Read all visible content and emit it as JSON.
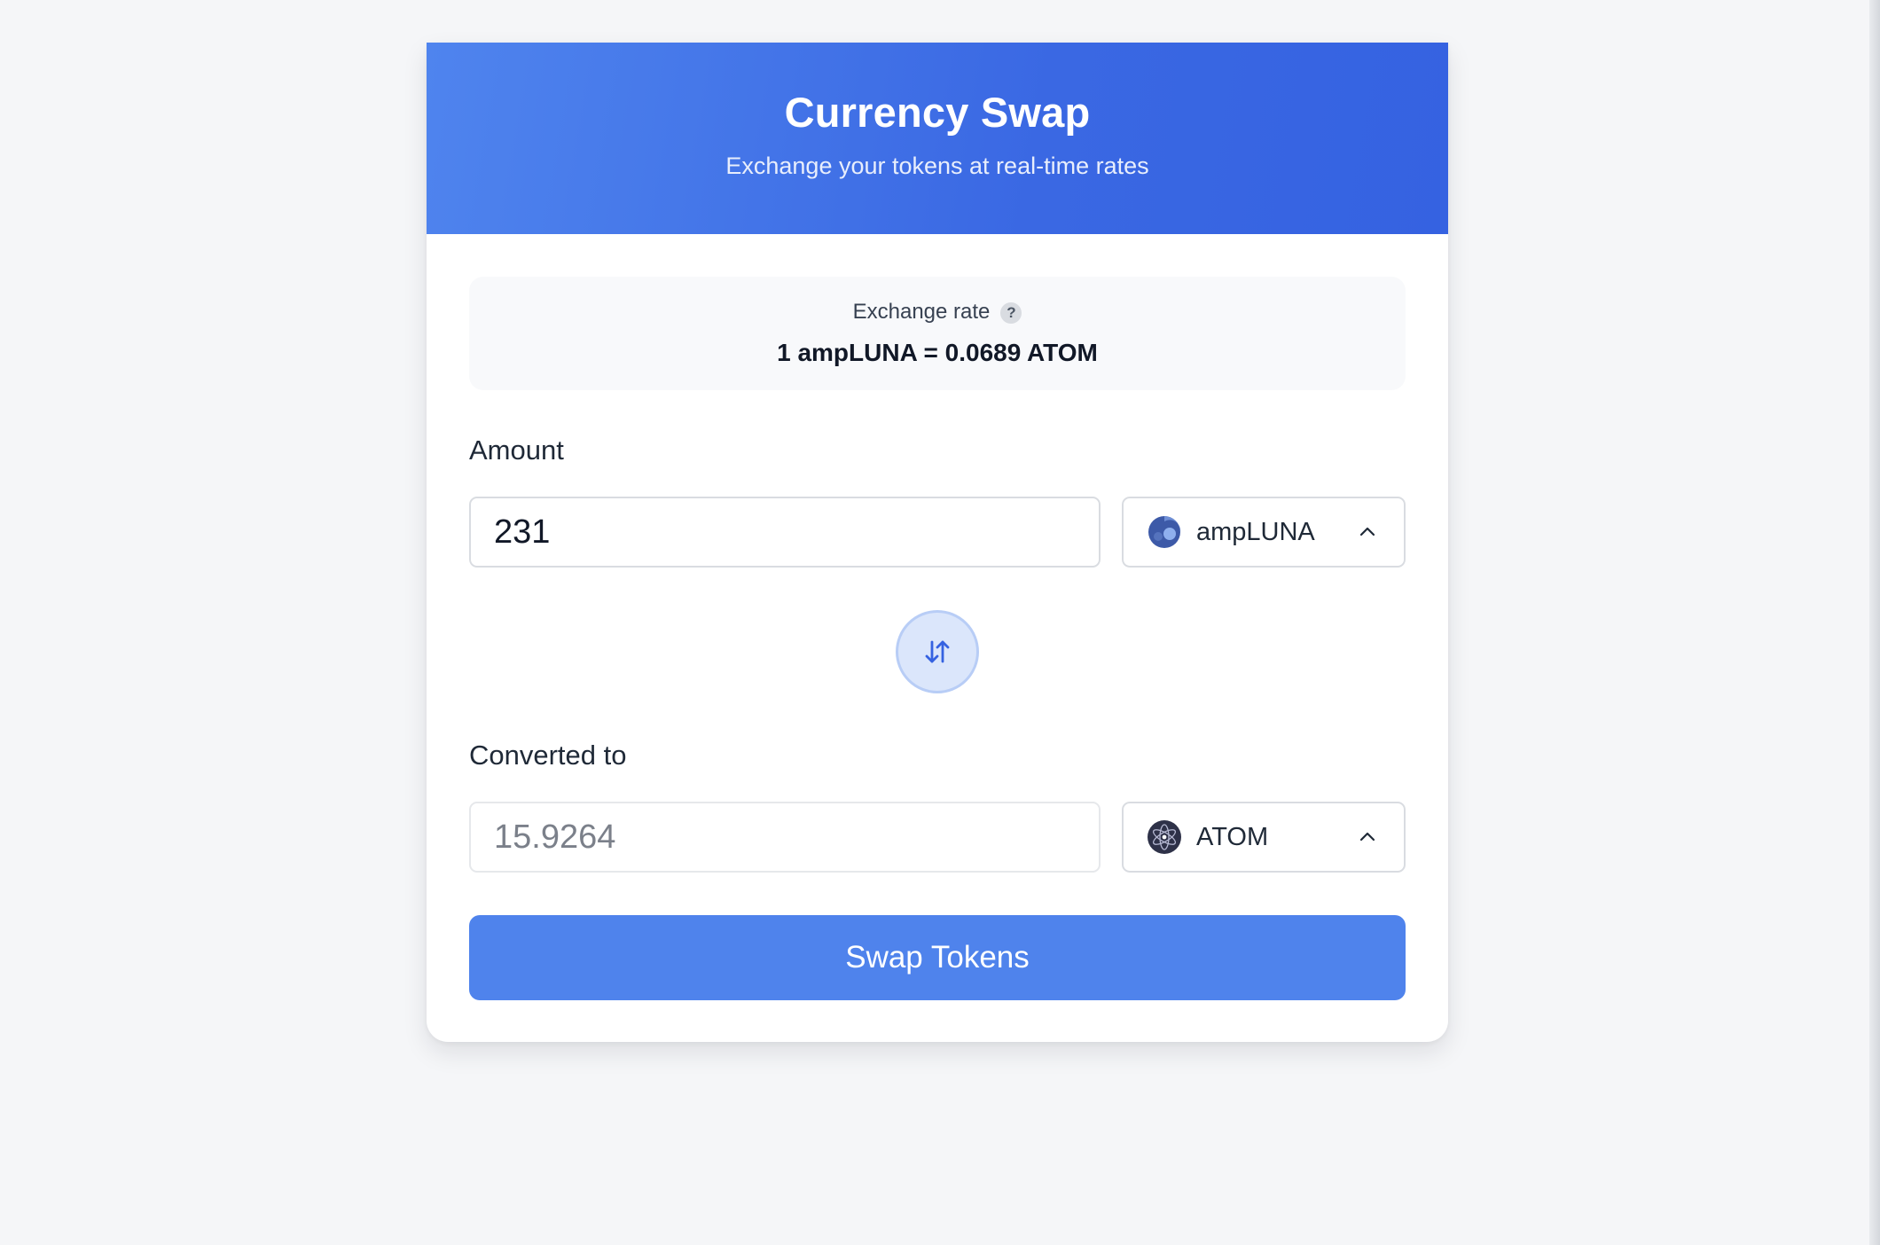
{
  "header": {
    "title": "Currency Swap",
    "subtitle": "Exchange your tokens at real-time rates"
  },
  "rate": {
    "label": "Exchange rate",
    "help_icon": "question-mark-icon",
    "help_glyph": "?",
    "value": "1 ampLUNA = 0.0689 ATOM"
  },
  "from": {
    "label": "Amount",
    "amount": "231",
    "token": {
      "name": "ampLUNA",
      "icon": "amplunatoken-icon"
    }
  },
  "to": {
    "label": "Converted to",
    "amount": "15.9264",
    "token": {
      "name": "ATOM",
      "icon": "atom-token-icon"
    }
  },
  "swap_direction_icon": "swap-vertical-arrows-icon",
  "swap_button": {
    "label": "Swap Tokens"
  },
  "colors": {
    "accent": "#4f83ec",
    "header_gradient_start": "#4f84ee",
    "header_gradient_end": "#3562e1"
  }
}
